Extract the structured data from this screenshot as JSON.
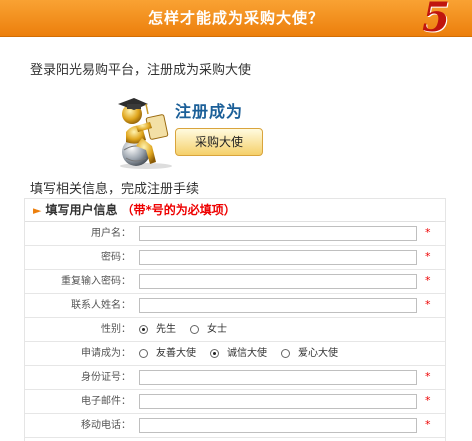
{
  "header": {
    "title": "怎样才能成为采购大使？",
    "step_number": "5"
  },
  "intro": {
    "text": "登录阳光易购平台，注册成为采购大使"
  },
  "badge": {
    "title": "注册成为",
    "button_label": "采购大使"
  },
  "section2": {
    "text": "填写相关信息，完成注册手续"
  },
  "form": {
    "title": "填写用户信息",
    "note": "（带*号的为必填项）",
    "required_mark": "*",
    "fields": {
      "username": {
        "label": "用户名：",
        "value": ""
      },
      "password": {
        "label": "密码：",
        "value": ""
      },
      "confirm_password": {
        "label": "重复输入密码：",
        "value": ""
      },
      "contact_name": {
        "label": "联系人姓名：",
        "value": ""
      },
      "gender": {
        "label": "性别：",
        "options": [
          "先生",
          "女士"
        ],
        "selected": "先生"
      },
      "apply_as": {
        "label": "申请成为：",
        "options": [
          "友善大使",
          "诚信大使",
          "爱心大使"
        ],
        "selected": "诚信大使"
      },
      "id_number": {
        "label": "身份证号：",
        "value": ""
      },
      "email": {
        "label": "电子邮件：",
        "value": ""
      },
      "mobile": {
        "label": "移动电话：",
        "value": ""
      }
    }
  }
}
